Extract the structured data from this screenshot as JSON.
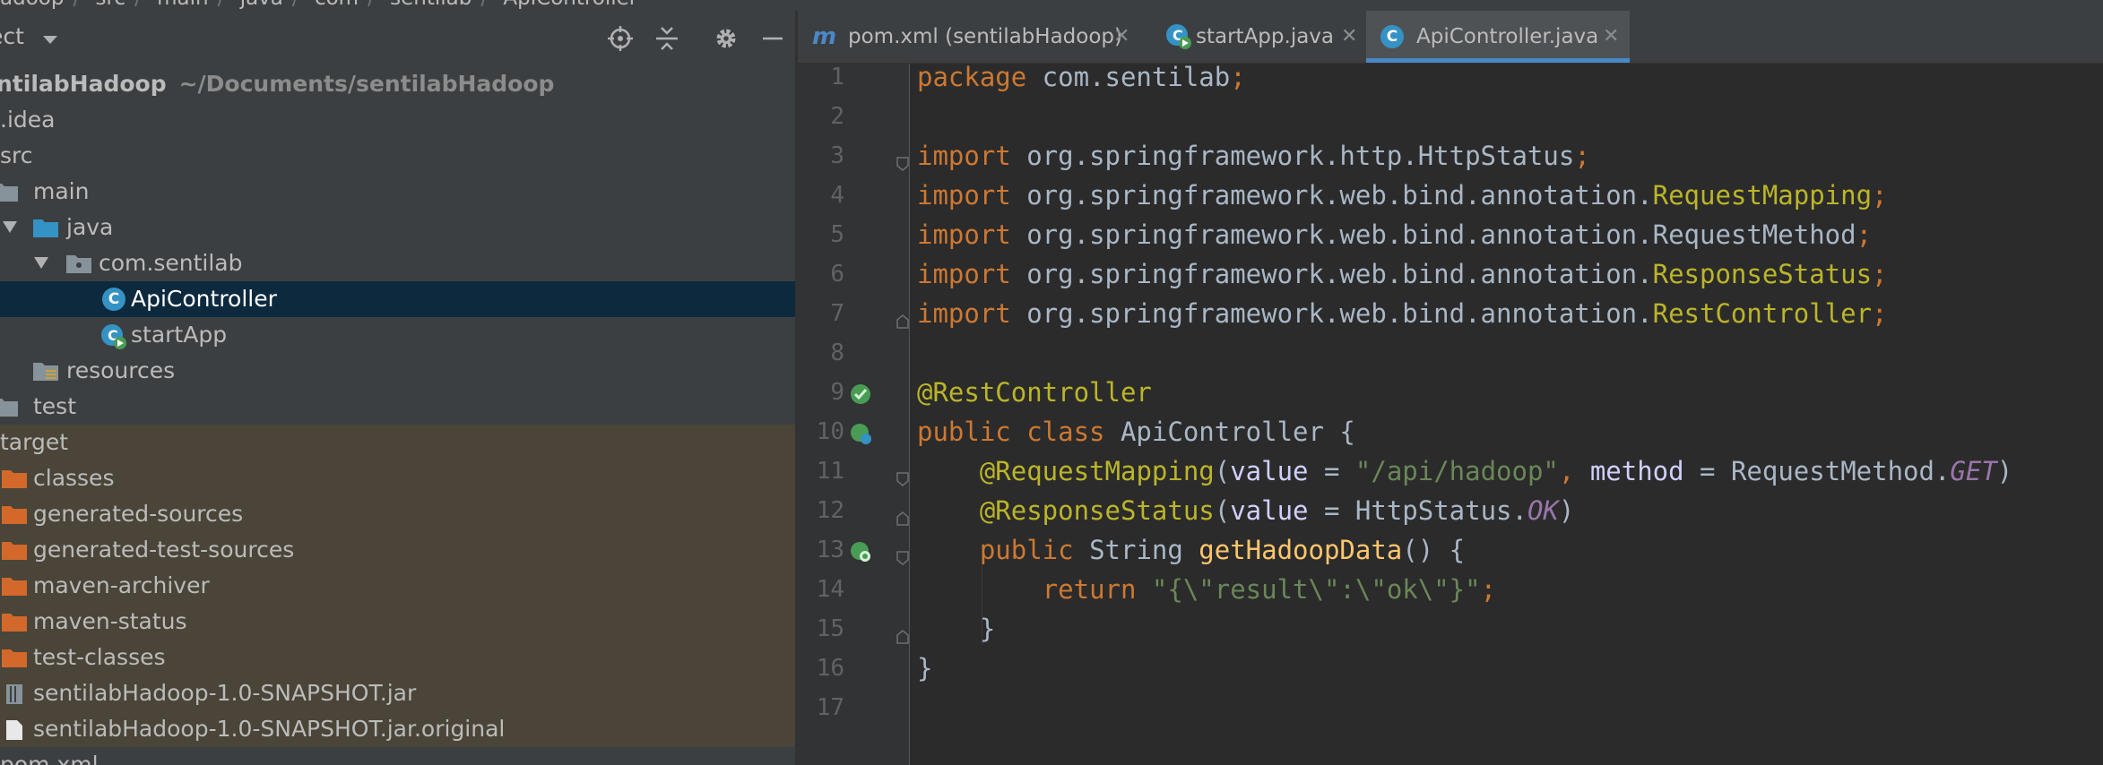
{
  "breadcrumb": [
    "adoop",
    "src",
    "main",
    "java",
    "com",
    "sentilab",
    "ApiController"
  ],
  "project_panel": {
    "title": "ect",
    "root": {
      "name": "ntilabHadoop",
      "path": "~/Documents/sentilabHadoop"
    },
    "items": [
      {
        "label": ".idea"
      },
      {
        "label": "src"
      },
      {
        "label": "main"
      },
      {
        "label": "java"
      },
      {
        "label": "com.sentilab"
      },
      {
        "label": "ApiController"
      },
      {
        "label": "startApp"
      },
      {
        "label": "resources"
      },
      {
        "label": "test"
      },
      {
        "label": "target"
      },
      {
        "label": "classes"
      },
      {
        "label": "generated-sources"
      },
      {
        "label": "generated-test-sources"
      },
      {
        "label": "maven-archiver"
      },
      {
        "label": "maven-status"
      },
      {
        "label": "test-classes"
      },
      {
        "label": "sentilabHadoop-1.0-SNAPSHOT.jar"
      },
      {
        "label": "sentilabHadoop-1.0-SNAPSHOT.jar.original"
      },
      {
        "label": "pom.xml"
      }
    ]
  },
  "tabs": [
    {
      "icon": "m",
      "label": "pom.xml (sentilabHadoop)"
    },
    {
      "label": "startApp.java"
    },
    {
      "label": "ApiController.java"
    }
  ],
  "line_numbers": [
    "1",
    "2",
    "3",
    "4",
    "5",
    "6",
    "7",
    "8",
    "9",
    "10",
    "11",
    "12",
    "13",
    "14",
    "15",
    "16",
    "17"
  ],
  "code": {
    "l1": [
      "package",
      " com.sentilab",
      ";"
    ],
    "l3": [
      "import",
      " org.springframework.http.HttpStatus",
      ";"
    ],
    "l4": [
      "import",
      " org.springframework.web.bind.annotation.",
      "RequestMapping",
      ";"
    ],
    "l5": [
      "import",
      " org.springframework.web.bind.annotation.RequestMethod",
      ";"
    ],
    "l6": [
      "import",
      " org.springframework.web.bind.annotation.",
      "ResponseStatus",
      ";"
    ],
    "l7": [
      "import",
      " org.springframework.web.bind.annotation.",
      "RestController",
      ";"
    ],
    "l9": [
      "@RestController"
    ],
    "l10": [
      "public class",
      " ApiController {"
    ],
    "l11": [
      "@RequestMapping",
      "(",
      "value",
      " = ",
      "\"/api/hadoop\"",
      ", ",
      "method",
      " = RequestMethod.",
      "GET",
      ")"
    ],
    "l12": [
      "@ResponseStatus",
      "(",
      "value",
      " = HttpStatus.",
      "OK",
      ")"
    ],
    "l13": [
      "public",
      " String ",
      "getHadoopData",
      "() {"
    ],
    "l14": [
      "return",
      " ",
      "\"{\\\"result\\\":\\\"ok\\\"}\"",
      ";"
    ],
    "l15": [
      "}"
    ],
    "l16": [
      "}"
    ]
  },
  "colors": {
    "keyword": "#cc7832",
    "annotation": "#bbb529",
    "string": "#6a8759",
    "constant": "#9876aa",
    "method": "#ffc66d",
    "selection": "#0d293e",
    "excluded_folder": "#4a4538"
  }
}
